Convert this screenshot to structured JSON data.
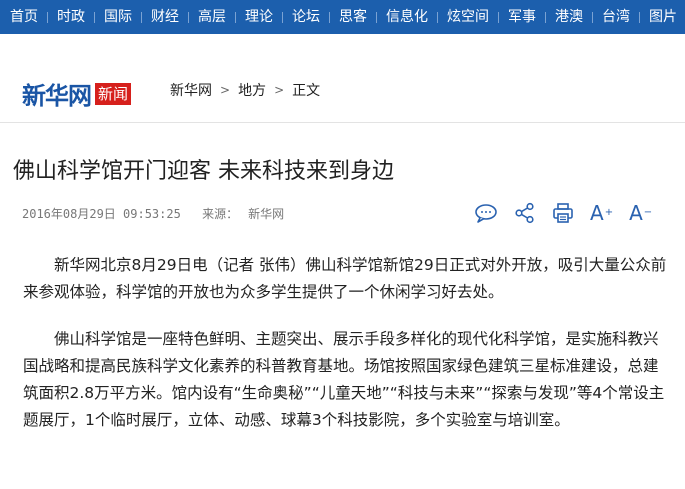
{
  "nav": {
    "items": [
      "首页",
      "时政",
      "国际",
      "财经",
      "高层",
      "理论",
      "论坛",
      "思客",
      "信息化",
      "炫空间",
      "军事",
      "港澳",
      "台湾",
      "图片"
    ]
  },
  "header": {
    "logo_text": "新华网",
    "logo_badge": "新闻",
    "breadcrumb": [
      "新华网",
      "地方",
      "正文"
    ]
  },
  "article": {
    "title": "佛山科学馆开门迎客 未来科技来到身边",
    "datetime": "2016年08月29日 09:53:25",
    "source_label": "来源：",
    "source": "新华网",
    "paragraphs": [
      "新华网北京8月29日电（记者 张伟）佛山科学馆新馆29日正式对外开放，吸引大量公众前来参观体验，科学馆的开放也为众多学生提供了一个休闲学习好去处。",
      "佛山科学馆是一座特色鲜明、主题突出、展示手段多样化的现代化科学馆，是实施科教兴国战略和提高民族科学文化素养的科普教育基地。场馆按照国家绿色建筑三星标准建设，总建筑面积2.8万平方米。馆内设有“生命奥秘”“儿童天地”“科技与未来”“探索与发现”等4个常设主题展厅，1个临时展厅，立体、动感、球幕3个科技影院，多个实验室与培训室。"
    ]
  },
  "tools": {
    "icons": [
      "comment-icon",
      "share-icon",
      "print-icon",
      "font-increase-icon",
      "font-decrease-icon"
    ],
    "font_up_label": "A",
    "font_down_label": "A"
  },
  "colors": {
    "nav_bg": "#1c5fad",
    "brand_blue": "#1a55a5",
    "badge_red": "#d6201c"
  }
}
